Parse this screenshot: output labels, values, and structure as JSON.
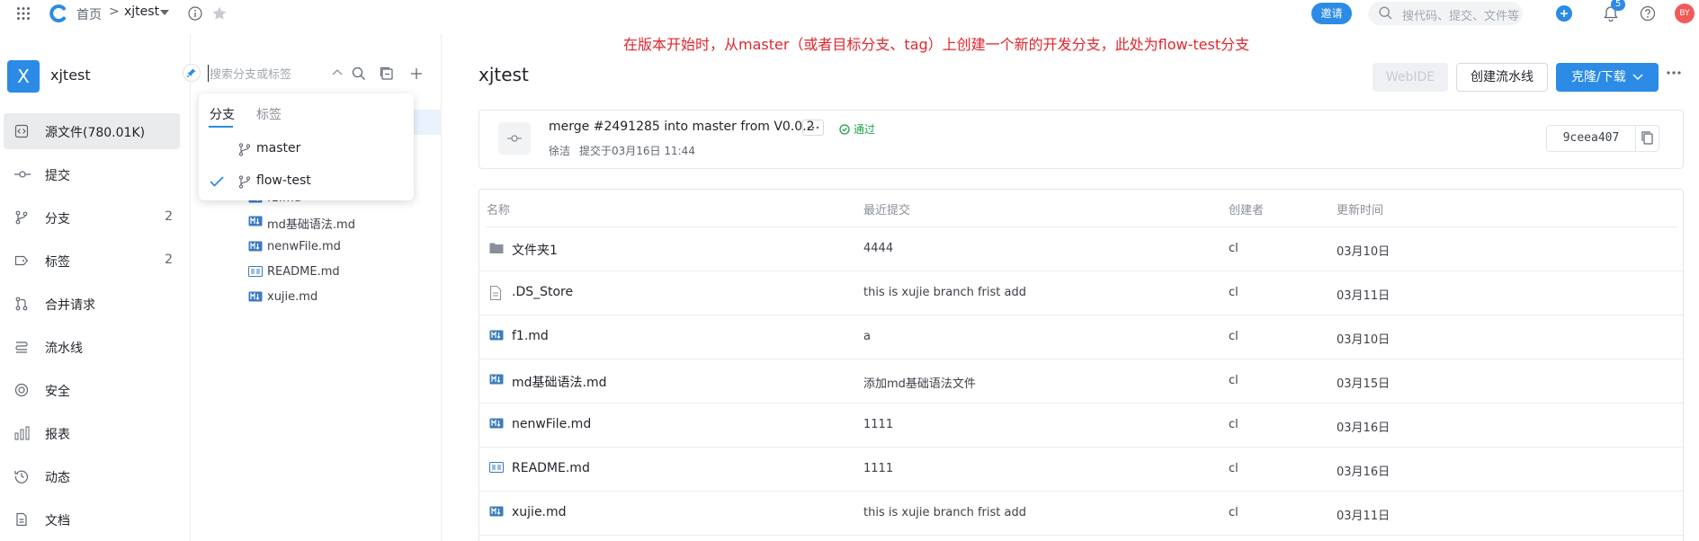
{
  "topbar": {
    "home": "首页",
    "breadcrumb_sep": ">",
    "repo": "xjtest",
    "invite": "邀请",
    "search_placeholder": "搜代码、提交、文件等",
    "notif_count": "5",
    "avatar_initials": "BY"
  },
  "annotation": "在版本开始时，从master（或者目标分支、tag）上创建一个新的开发分支，此处为flow-test分支",
  "sidebar": {
    "repo_initial": "X",
    "repo_name": "xjtest",
    "items": [
      {
        "label": "源文件(780.01K)",
        "icon": "code-icon",
        "count": "",
        "active": true
      },
      {
        "label": "提交",
        "icon": "commit-icon",
        "count": ""
      },
      {
        "label": "分支",
        "icon": "branch-icon",
        "count": "2"
      },
      {
        "label": "标签",
        "icon": "tag-icon",
        "count": "2"
      },
      {
        "label": "合并请求",
        "icon": "merge-request-icon",
        "count": ""
      },
      {
        "label": "流水线",
        "icon": "pipeline-icon",
        "count": ""
      },
      {
        "label": "安全",
        "icon": "security-icon",
        "count": ""
      },
      {
        "label": "报表",
        "icon": "report-icon",
        "count": ""
      },
      {
        "label": "动态",
        "icon": "activity-icon",
        "count": ""
      },
      {
        "label": "文档",
        "icon": "docs-icon",
        "count": ""
      }
    ]
  },
  "tree": {
    "search_placeholder": "搜索分支或标签",
    "files": [
      {
        "name": "f1.md",
        "icon": "markdown-icon"
      },
      {
        "name": "md基础语法.md",
        "icon": "markdown-icon"
      },
      {
        "name": "nenwFile.md",
        "icon": "markdown-icon"
      },
      {
        "name": "README.md",
        "icon": "readme-icon"
      },
      {
        "name": "xujie.md",
        "icon": "markdown-icon"
      }
    ]
  },
  "dropdown": {
    "tab_branches": "分支",
    "tab_tags": "标签",
    "options": [
      {
        "label": "master",
        "selected": false
      },
      {
        "label": "flow-test",
        "selected": true
      }
    ]
  },
  "main": {
    "title": "xjtest",
    "btn_webide": "WebIDE",
    "btn_pipeline": "创建流水线",
    "btn_clone": "克隆/下载",
    "commit": {
      "message": "merge #2491285 into master from V0.0.2",
      "status": "通过",
      "author": "徐洁",
      "time": "提交于03月16日 11:44",
      "sha": "9ceea407"
    },
    "table": {
      "headers": {
        "name": "名称",
        "commit": "最近提交",
        "author": "创建者",
        "time": "更新时间"
      },
      "rows": [
        {
          "name": "文件夹1",
          "icon": "folder-icon",
          "commit": "4444",
          "author": "cl",
          "time": "03月10日"
        },
        {
          "name": ".DS_Store",
          "icon": "file-icon",
          "commit": "this is xujie branch frist add",
          "author": "cl",
          "time": "03月11日"
        },
        {
          "name": "f1.md",
          "icon": "markdown-icon",
          "commit": "a",
          "author": "cl",
          "time": "03月10日"
        },
        {
          "name": "md基础语法.md",
          "icon": "markdown-icon",
          "commit": "添加md基础语法文件",
          "author": "cl",
          "time": "03月15日"
        },
        {
          "name": "nenwFile.md",
          "icon": "markdown-icon",
          "commit": "1111",
          "author": "cl",
          "time": "03月16日"
        },
        {
          "name": "README.md",
          "icon": "readme-icon",
          "commit": "1111",
          "author": "cl",
          "time": "03月16日"
        },
        {
          "name": "xujie.md",
          "icon": "markdown-icon",
          "commit": "this is xujie branch frist add",
          "author": "cl",
          "time": "03月11日"
        }
      ]
    }
  },
  "colors": {
    "accent": "#2b8be6",
    "annotation": "#e0262d",
    "success": "#1aa34a"
  }
}
